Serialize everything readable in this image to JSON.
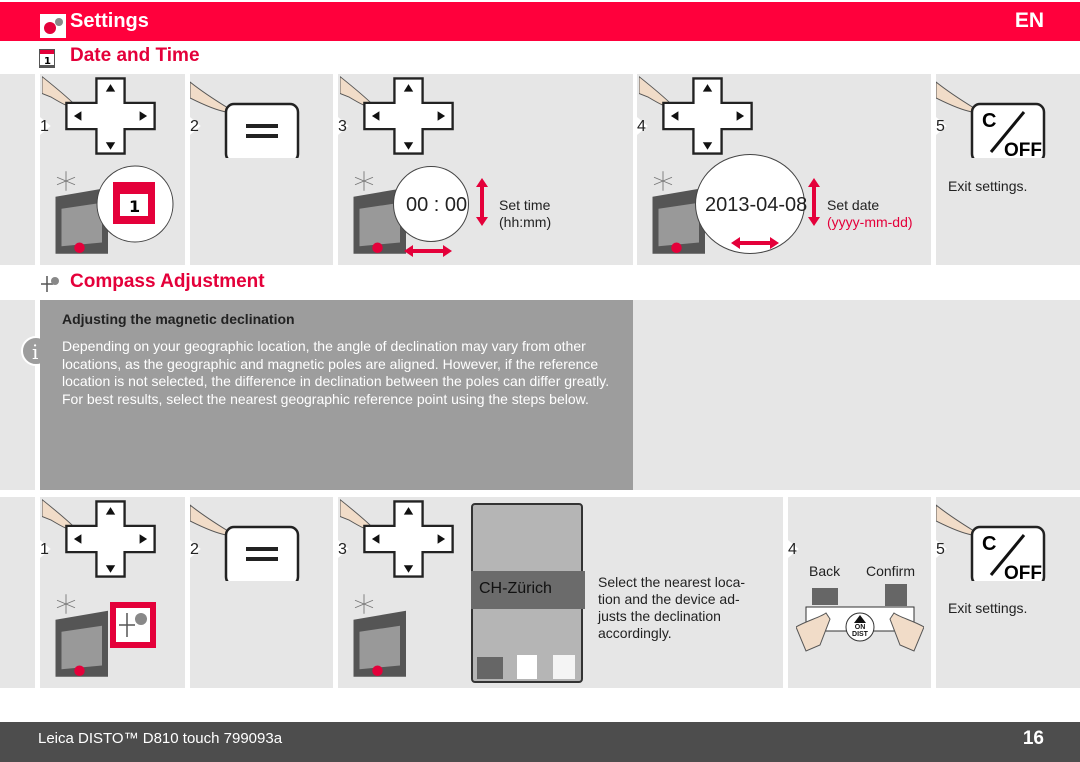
{
  "header": {
    "title": "Settings",
    "language": "EN",
    "icon": "settings-gears-icon"
  },
  "date_time": {
    "heading": "Date and Time",
    "icon": "calendar-icon",
    "steps": [
      {
        "number": "1",
        "icon": "dpad-icon"
      },
      {
        "number": "2",
        "icon": "equals-button-icon"
      },
      {
        "number": "3",
        "icon": "dpad-icon",
        "display": "00 : 00",
        "label": "Set time",
        "format": "(hh:mm)"
      },
      {
        "number": "4",
        "icon": "dpad-icon",
        "display": "2013-04-08",
        "label": "Set date",
        "format": "(yyyy-mm-dd)"
      },
      {
        "number": "5",
        "icon": "c-off-button-icon",
        "label": "Exit settings."
      }
    ]
  },
  "compass": {
    "heading": "Compass Adjustment",
    "icon": "compass-icon",
    "info": {
      "title": "Adjusting the magnetic declination",
      "text": "Depending on your geographic location, the angle of declination may vary from other locations, as the geographic and magnetic poles are aligned. However, if the reference location is not selected, the difference in declination between the poles can differ greatly. For best results, select the nearest geographic reference point using the steps below."
    },
    "steps": [
      {
        "number": "1",
        "icon": "dpad-icon"
      },
      {
        "number": "2",
        "icon": "equals-button-icon"
      },
      {
        "number": "3",
        "icon": "dpad-icon",
        "screen_item": "CH-Zürich",
        "label": "Select the nearest loca-\ntion and the device ad-\njusts the declination\naccordingly."
      },
      {
        "number": "4",
        "back": "Back",
        "confirm": "Confirm",
        "button": "ON DIST"
      },
      {
        "number": "5",
        "icon": "c-off-button-icon",
        "label": "Exit settings."
      }
    ]
  },
  "footer": {
    "product": "Leica DISTO™ D810 touch 799093a",
    "page": "16"
  },
  "colors": {
    "accent": "#ff003c",
    "panel": "#e6e6e6",
    "info_box": "#9d9d9d",
    "footer": "#4d4d4d"
  }
}
